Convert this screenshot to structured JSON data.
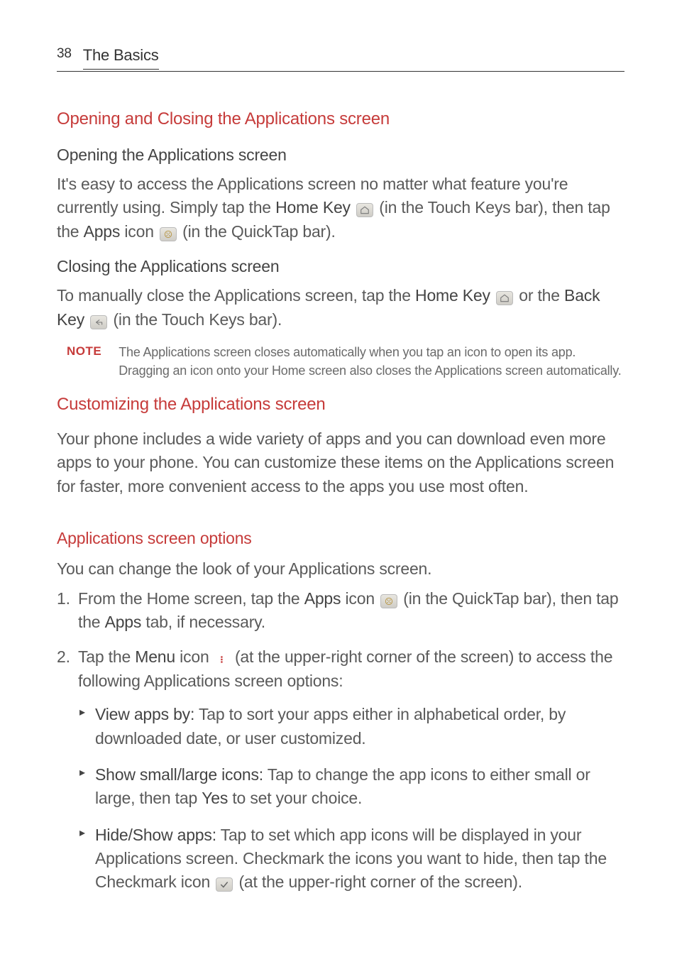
{
  "page": {
    "number": "38",
    "section": "The Basics"
  },
  "headings": {
    "h2_opening_closing": "Opening and Closing the Applications screen",
    "h3_opening": "Opening the Applications screen",
    "h3_closing": "Closing the Applications screen",
    "h2_customizing": "Customizing the Applications screen",
    "h2_options": "Applications screen options"
  },
  "text": {
    "open_p1a": "It's easy to access the Applications screen no matter what feature you're currently using. Simply tap the ",
    "home_key": "Home Key",
    "open_p1b": " (in the Touch Keys bar), then tap the ",
    "apps": "Apps",
    "open_p1c": " icon ",
    "open_p1d": " (in the QuickTap bar).",
    "close_p1a": "To manually close the Applications screen, tap the ",
    "close_p1b": " or the ",
    "back_key": "Back Key",
    "close_p1c": " (in the Touch Keys bar).",
    "note_label": "NOTE",
    "note_text": "The Applications screen closes automatically when you tap an icon to open its app. Dragging an icon onto your Home screen also closes the Applications screen automatically.",
    "customize_p": "Your phone includes a wide variety of apps and you can download even more apps to your phone. You can customize these items on the Applications screen for faster, more convenient access to the apps you use most often.",
    "options_intro": "You can change the look of your Applications screen.",
    "step1a": "From the Home screen, tap the ",
    "step1b": " icon ",
    "step1c": " (in the QuickTap bar), then tap the ",
    "step1d": " tab, if necessary.",
    "step2a": "Tap the ",
    "menu": "Menu",
    "step2b": " icon ",
    "step2c": " (at the upper-right corner of the screen) to access the following Applications screen options:",
    "bullet1_label": "View apps by:",
    "bullet1_text": " Tap to sort your apps either in alphabetical order, by downloaded date, or user customized.",
    "bullet2_label": "Show small/large icons:",
    "bullet2_text_a": " Tap to change the app icons to either small or large, then tap ",
    "yes": "Yes",
    "bullet2_text_b": " to set your choice.",
    "bullet3_label": "Hide/Show apps:",
    "bullet3_text_a": " Tap to set which app icons will be displayed in your Applications screen. Checkmark the icons you want to hide, then tap the Checkmark icon ",
    "bullet3_text_b": " (at the upper-right corner of the screen)."
  }
}
